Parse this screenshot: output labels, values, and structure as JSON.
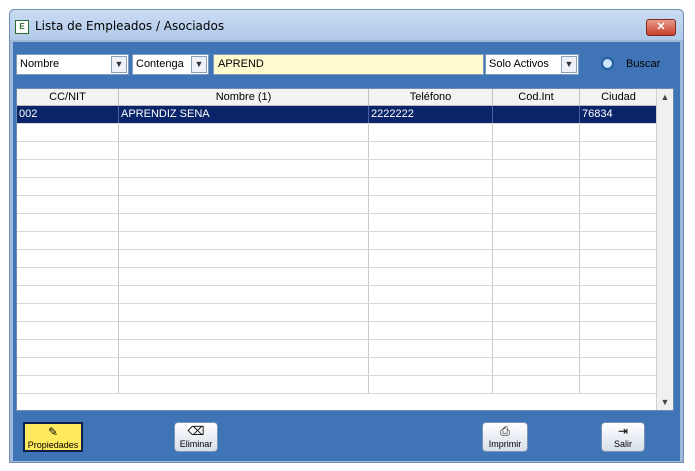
{
  "window": {
    "title": "Lista de Empleados / Asociados",
    "close_glyph": "✕"
  },
  "filters": {
    "field": {
      "value": "Nombre"
    },
    "operator": {
      "value": "Contenga"
    },
    "search": {
      "value": "APREND"
    },
    "status": {
      "value": "Solo Activos"
    },
    "search_button": {
      "label": "Buscar",
      "icon": "search-icon"
    }
  },
  "grid": {
    "columns": [
      "CC/NIT",
      "Nombre (1)",
      "Teléfono",
      "Cod.Int",
      "Ciudad"
    ],
    "rows": [
      [
        "002",
        "APRENDIZ SENA",
        "2222222",
        "",
        "76834"
      ]
    ],
    "selected_row": 0,
    "empty_rows": 15
  },
  "toolbar": {
    "propiedades": {
      "label": "Propiedades",
      "icon": "properties-icon"
    },
    "eliminar": {
      "label": "Eliminar",
      "icon": "eraser-icon"
    },
    "imprimir": {
      "label": "Imprimir",
      "icon": "printer-icon"
    },
    "salir": {
      "label": "Salir",
      "icon": "exit-icon"
    }
  },
  "colors": {
    "window_frame": "#9eb9d8",
    "panel": "#3f75b7",
    "selection": "#0a246a",
    "input_highlight": "#fffbcf",
    "active_button": "#ffe95c"
  }
}
